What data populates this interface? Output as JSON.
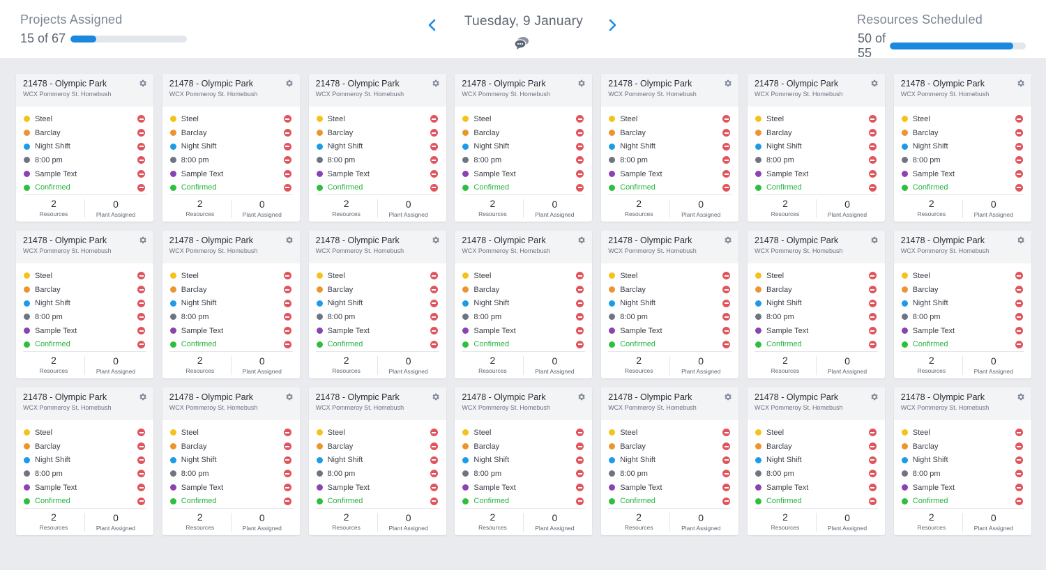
{
  "header": {
    "projects": {
      "title": "Projects Assigned",
      "value": "15 of 67",
      "progress": 0.224
    },
    "date": "Tuesday, 9 January",
    "resources": {
      "title": "Resources Scheduled",
      "value": "50 of 55",
      "progress": 0.909
    }
  },
  "colors": {
    "steel": "#f4c21b",
    "barclay": "#ec9530",
    "night_shift": "#1d9be6",
    "time": "#6e7580",
    "sample": "#8a43b0",
    "confirmed": "#2fbf3f",
    "accent": "#1b88e0"
  },
  "icons": {
    "prev": "chevron-left-icon",
    "next": "chevron-right-icon",
    "chat": "chat-bubbles-icon",
    "settings": "gear-icon",
    "remove": "remove-circle-icon"
  },
  "cards": [
    {
      "title": "21478 - Olympic Park",
      "subtitle": "WCX Pommeroy St. Homebush",
      "items": [
        {
          "label": "Steel",
          "color": "#f4c21b"
        },
        {
          "label": "Barclay",
          "color": "#ec9530"
        },
        {
          "label": "Night Shift",
          "color": "#1d9be6"
        },
        {
          "label": "8:00 pm",
          "color": "#6e7580"
        },
        {
          "label": "Sample Text",
          "color": "#8a43b0"
        },
        {
          "label": "Confirmed",
          "color": "#2fbf3f",
          "status": true
        }
      ],
      "resources": "2",
      "resources_label": "Resources",
      "plant": "0",
      "plant_label": "Plant Assigned"
    },
    {
      "title": "21478 - Olympic Park",
      "subtitle": "WCX Pommeroy St. Homebush",
      "items": [
        {
          "label": "Steel",
          "color": "#f4c21b"
        },
        {
          "label": "Barclay",
          "color": "#ec9530"
        },
        {
          "label": "Night Shift",
          "color": "#1d9be6"
        },
        {
          "label": "8:00 pm",
          "color": "#6e7580"
        },
        {
          "label": "Sample Text",
          "color": "#8a43b0"
        },
        {
          "label": "Confirmed",
          "color": "#2fbf3f",
          "status": true
        }
      ],
      "resources": "2",
      "resources_label": "Resources",
      "plant": "0",
      "plant_label": "Plant Assigned"
    },
    {
      "title": "21478 - Olympic Park",
      "subtitle": "WCX Pommeroy St. Homebush",
      "items": [
        {
          "label": "Steel",
          "color": "#f4c21b"
        },
        {
          "label": "Barclay",
          "color": "#ec9530"
        },
        {
          "label": "Night Shift",
          "color": "#1d9be6"
        },
        {
          "label": "8:00 pm",
          "color": "#6e7580"
        },
        {
          "label": "Sample Text",
          "color": "#8a43b0"
        },
        {
          "label": "Confirmed",
          "color": "#2fbf3f",
          "status": true
        }
      ],
      "resources": "2",
      "resources_label": "Resources",
      "plant": "0",
      "plant_label": "Plant Assigned"
    },
    {
      "title": "21478 - Olympic Park",
      "subtitle": "WCX Pommeroy St. Homebush",
      "items": [
        {
          "label": "Steel",
          "color": "#f4c21b"
        },
        {
          "label": "Barclay",
          "color": "#ec9530"
        },
        {
          "label": "Night Shift",
          "color": "#1d9be6"
        },
        {
          "label": "8:00 pm",
          "color": "#6e7580"
        },
        {
          "label": "Sample Text",
          "color": "#8a43b0"
        },
        {
          "label": "Confirmed",
          "color": "#2fbf3f",
          "status": true
        }
      ],
      "resources": "2",
      "resources_label": "Resources",
      "plant": "0",
      "plant_label": "Plant Assigned"
    },
    {
      "title": "21478 - Olympic Park",
      "subtitle": "WCX Pommeroy St. Homebush",
      "items": [
        {
          "label": "Steel",
          "color": "#f4c21b"
        },
        {
          "label": "Barclay",
          "color": "#ec9530"
        },
        {
          "label": "Night Shift",
          "color": "#1d9be6"
        },
        {
          "label": "8:00 pm",
          "color": "#6e7580"
        },
        {
          "label": "Sample Text",
          "color": "#8a43b0"
        },
        {
          "label": "Confirmed",
          "color": "#2fbf3f",
          "status": true
        }
      ],
      "resources": "2",
      "resources_label": "Resources",
      "plant": "0",
      "plant_label": "Plant Assigned"
    },
    {
      "title": "21478 - Olympic Park",
      "subtitle": "WCX Pommeroy St. Homebush",
      "items": [
        {
          "label": "Steel",
          "color": "#f4c21b"
        },
        {
          "label": "Barclay",
          "color": "#ec9530"
        },
        {
          "label": "Night Shift",
          "color": "#1d9be6"
        },
        {
          "label": "8:00 pm",
          "color": "#6e7580"
        },
        {
          "label": "Sample Text",
          "color": "#8a43b0"
        },
        {
          "label": "Confirmed",
          "color": "#2fbf3f",
          "status": true
        }
      ],
      "resources": "2",
      "resources_label": "Resources",
      "plant": "0",
      "plant_label": "Plant Assigned"
    },
    {
      "title": "21478 - Olympic Park",
      "subtitle": "WCX Pommeroy St. Homebush",
      "items": [
        {
          "label": "Steel",
          "color": "#f4c21b"
        },
        {
          "label": "Barclay",
          "color": "#ec9530"
        },
        {
          "label": "Night Shift",
          "color": "#1d9be6"
        },
        {
          "label": "8:00 pm",
          "color": "#6e7580"
        },
        {
          "label": "Sample Text",
          "color": "#8a43b0"
        },
        {
          "label": "Confirmed",
          "color": "#2fbf3f",
          "status": true
        }
      ],
      "resources": "2",
      "resources_label": "Resources",
      "plant": "0",
      "plant_label": "Plant Assigned"
    },
    {
      "title": "21478 - Olympic Park",
      "subtitle": "WCX Pommeroy St. Homebush",
      "items": [
        {
          "label": "Steel",
          "color": "#f4c21b"
        },
        {
          "label": "Barclay",
          "color": "#ec9530"
        },
        {
          "label": "Night Shift",
          "color": "#1d9be6"
        },
        {
          "label": "8:00 pm",
          "color": "#6e7580"
        },
        {
          "label": "Sample Text",
          "color": "#8a43b0"
        },
        {
          "label": "Confirmed",
          "color": "#2fbf3f",
          "status": true
        }
      ],
      "resources": "2",
      "resources_label": "Resources",
      "plant": "0",
      "plant_label": "Plant Assigned"
    },
    {
      "title": "21478 - Olympic Park",
      "subtitle": "WCX Pommeroy St. Homebush",
      "items": [
        {
          "label": "Steel",
          "color": "#f4c21b"
        },
        {
          "label": "Barclay",
          "color": "#ec9530"
        },
        {
          "label": "Night Shift",
          "color": "#1d9be6"
        },
        {
          "label": "8:00 pm",
          "color": "#6e7580"
        },
        {
          "label": "Sample Text",
          "color": "#8a43b0"
        },
        {
          "label": "Confirmed",
          "color": "#2fbf3f",
          "status": true
        }
      ],
      "resources": "2",
      "resources_label": "Resources",
      "plant": "0",
      "plant_label": "Plant Assigned"
    },
    {
      "title": "21478 - Olympic Park",
      "subtitle": "WCX Pommeroy St. Homebush",
      "items": [
        {
          "label": "Steel",
          "color": "#f4c21b"
        },
        {
          "label": "Barclay",
          "color": "#ec9530"
        },
        {
          "label": "Night Shift",
          "color": "#1d9be6"
        },
        {
          "label": "8:00 pm",
          "color": "#6e7580"
        },
        {
          "label": "Sample Text",
          "color": "#8a43b0"
        },
        {
          "label": "Confirmed",
          "color": "#2fbf3f",
          "status": true
        }
      ],
      "resources": "2",
      "resources_label": "Resources",
      "plant": "0",
      "plant_label": "Plant Assigned"
    },
    {
      "title": "21478 - Olympic Park",
      "subtitle": "WCX Pommeroy St. Homebush",
      "items": [
        {
          "label": "Steel",
          "color": "#f4c21b"
        },
        {
          "label": "Barclay",
          "color": "#ec9530"
        },
        {
          "label": "Night Shift",
          "color": "#1d9be6"
        },
        {
          "label": "8:00 pm",
          "color": "#6e7580"
        },
        {
          "label": "Sample Text",
          "color": "#8a43b0"
        },
        {
          "label": "Confirmed",
          "color": "#2fbf3f",
          "status": true
        }
      ],
      "resources": "2",
      "resources_label": "Resources",
      "plant": "0",
      "plant_label": "Plant Assigned"
    },
    {
      "title": "21478 - Olympic Park",
      "subtitle": "WCX Pommeroy St. Homebush",
      "items": [
        {
          "label": "Steel",
          "color": "#f4c21b"
        },
        {
          "label": "Barclay",
          "color": "#ec9530"
        },
        {
          "label": "Night Shift",
          "color": "#1d9be6"
        },
        {
          "label": "8:00 pm",
          "color": "#6e7580"
        },
        {
          "label": "Sample Text",
          "color": "#8a43b0"
        },
        {
          "label": "Confirmed",
          "color": "#2fbf3f",
          "status": true
        }
      ],
      "resources": "2",
      "resources_label": "Resources",
      "plant": "0",
      "plant_label": "Plant Assigned"
    },
    {
      "title": "21478 - Olympic Park",
      "subtitle": "WCX Pommeroy St. Homebush",
      "items": [
        {
          "label": "Steel",
          "color": "#f4c21b"
        },
        {
          "label": "Barclay",
          "color": "#ec9530"
        },
        {
          "label": "Night Shift",
          "color": "#1d9be6"
        },
        {
          "label": "8:00 pm",
          "color": "#6e7580"
        },
        {
          "label": "Sample Text",
          "color": "#8a43b0"
        },
        {
          "label": "Confirmed",
          "color": "#2fbf3f",
          "status": true
        }
      ],
      "resources": "2",
      "resources_label": "Resources",
      "plant": "0",
      "plant_label": "Plant Assigned"
    },
    {
      "title": "21478 - Olympic Park",
      "subtitle": "WCX Pommeroy St. Homebush",
      "items": [
        {
          "label": "Steel",
          "color": "#f4c21b"
        },
        {
          "label": "Barclay",
          "color": "#ec9530"
        },
        {
          "label": "Night Shift",
          "color": "#1d9be6"
        },
        {
          "label": "8:00 pm",
          "color": "#6e7580"
        },
        {
          "label": "Sample Text",
          "color": "#8a43b0"
        },
        {
          "label": "Confirmed",
          "color": "#2fbf3f",
          "status": true
        }
      ],
      "resources": "2",
      "resources_label": "Resources",
      "plant": "0",
      "plant_label": "Plant Assigned"
    },
    {
      "title": "21478 - Olympic Park",
      "subtitle": "WCX Pommeroy St. Homebush",
      "items": [
        {
          "label": "Steel",
          "color": "#f4c21b"
        },
        {
          "label": "Barclay",
          "color": "#ec9530"
        },
        {
          "label": "Night Shift",
          "color": "#1d9be6"
        },
        {
          "label": "8:00 pm",
          "color": "#6e7580"
        },
        {
          "label": "Sample Text",
          "color": "#8a43b0"
        },
        {
          "label": "Confirmed",
          "color": "#2fbf3f",
          "status": true
        }
      ],
      "resources": "2",
      "resources_label": "Resources",
      "plant": "0",
      "plant_label": "Plant Assigned"
    },
    {
      "title": "21478 - Olympic Park",
      "subtitle": "WCX Pommeroy St. Homebush",
      "items": [
        {
          "label": "Steel",
          "color": "#f4c21b"
        },
        {
          "label": "Barclay",
          "color": "#ec9530"
        },
        {
          "label": "Night Shift",
          "color": "#1d9be6"
        },
        {
          "label": "8:00 pm",
          "color": "#6e7580"
        },
        {
          "label": "Sample Text",
          "color": "#8a43b0"
        },
        {
          "label": "Confirmed",
          "color": "#2fbf3f",
          "status": true
        }
      ],
      "resources": "2",
      "resources_label": "Resources",
      "plant": "0",
      "plant_label": "Plant Assigned"
    },
    {
      "title": "21478 - Olympic Park",
      "subtitle": "WCX Pommeroy St. Homebush",
      "items": [
        {
          "label": "Steel",
          "color": "#f4c21b"
        },
        {
          "label": "Barclay",
          "color": "#ec9530"
        },
        {
          "label": "Night Shift",
          "color": "#1d9be6"
        },
        {
          "label": "8:00 pm",
          "color": "#6e7580"
        },
        {
          "label": "Sample Text",
          "color": "#8a43b0"
        },
        {
          "label": "Confirmed",
          "color": "#2fbf3f",
          "status": true
        }
      ],
      "resources": "2",
      "resources_label": "Resources",
      "plant": "0",
      "plant_label": "Plant Assigned"
    },
    {
      "title": "21478 - Olympic Park",
      "subtitle": "WCX Pommeroy St. Homebush",
      "items": [
        {
          "label": "Steel",
          "color": "#f4c21b"
        },
        {
          "label": "Barclay",
          "color": "#ec9530"
        },
        {
          "label": "Night Shift",
          "color": "#1d9be6"
        },
        {
          "label": "8:00 pm",
          "color": "#6e7580"
        },
        {
          "label": "Sample Text",
          "color": "#8a43b0"
        },
        {
          "label": "Confirmed",
          "color": "#2fbf3f",
          "status": true
        }
      ],
      "resources": "2",
      "resources_label": "Resources",
      "plant": "0",
      "plant_label": "Plant Assigned"
    },
    {
      "title": "21478 - Olympic Park",
      "subtitle": "WCX Pommeroy St. Homebush",
      "items": [
        {
          "label": "Steel",
          "color": "#f4c21b"
        },
        {
          "label": "Barclay",
          "color": "#ec9530"
        },
        {
          "label": "Night Shift",
          "color": "#1d9be6"
        },
        {
          "label": "8:00 pm",
          "color": "#6e7580"
        },
        {
          "label": "Sample Text",
          "color": "#8a43b0"
        },
        {
          "label": "Confirmed",
          "color": "#2fbf3f",
          "status": true
        }
      ],
      "resources": "2",
      "resources_label": "Resources",
      "plant": "0",
      "plant_label": "Plant Assigned"
    },
    {
      "title": "21478 - Olympic Park",
      "subtitle": "WCX Pommeroy St. Homebush",
      "items": [
        {
          "label": "Steel",
          "color": "#f4c21b"
        },
        {
          "label": "Barclay",
          "color": "#ec9530"
        },
        {
          "label": "Night Shift",
          "color": "#1d9be6"
        },
        {
          "label": "8:00 pm",
          "color": "#6e7580"
        },
        {
          "label": "Sample Text",
          "color": "#8a43b0"
        },
        {
          "label": "Confirmed",
          "color": "#2fbf3f",
          "status": true
        }
      ],
      "resources": "2",
      "resources_label": "Resources",
      "plant": "0",
      "plant_label": "Plant Assigned"
    },
    {
      "title": "21478 - Olympic Park",
      "subtitle": "WCX Pommeroy St. Homebush",
      "items": [
        {
          "label": "Steel",
          "color": "#f4c21b"
        },
        {
          "label": "Barclay",
          "color": "#ec9530"
        },
        {
          "label": "Night Shift",
          "color": "#1d9be6"
        },
        {
          "label": "8:00 pm",
          "color": "#6e7580"
        },
        {
          "label": "Sample Text",
          "color": "#8a43b0"
        },
        {
          "label": "Confirmed",
          "color": "#2fbf3f",
          "status": true
        }
      ],
      "resources": "2",
      "resources_label": "Resources",
      "plant": "0",
      "plant_label": "Plant Assigned"
    }
  ]
}
